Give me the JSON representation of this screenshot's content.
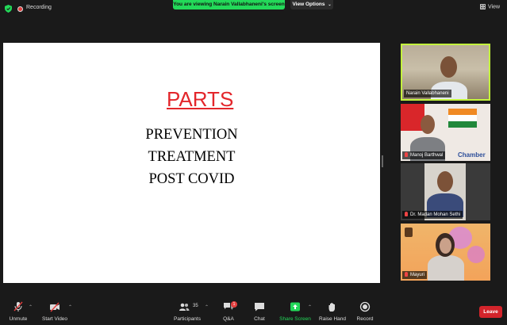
{
  "topbar": {
    "recording_label": "Recording",
    "viewing_banner": "You are viewing Narain Vallabhaneni's screen",
    "view_options_label": "View Options",
    "view_label": "View"
  },
  "slide": {
    "title": "PARTS",
    "lines": [
      "PREVENTION",
      "TREATMENT",
      "POST COVID"
    ]
  },
  "participants": [
    {
      "name": "Narain Vallabhaneni",
      "muted": false,
      "active": true
    },
    {
      "name": "Manoj Barthwal",
      "muted": true,
      "active": false,
      "background_text": "Chamber"
    },
    {
      "name": "Dr. Madan Mohan Sethi",
      "muted": true,
      "active": false
    },
    {
      "name": "Mayuri",
      "muted": true,
      "active": false
    }
  ],
  "toolbar": {
    "unmute_label": "Unmute",
    "start_video_label": "Start Video",
    "participants_label": "Participants",
    "participants_count": "35",
    "qa_label": "Q&A",
    "qa_badge": "1",
    "chat_label": "Chat",
    "share_screen_label": "Share Screen",
    "raise_hand_label": "Raise Hand",
    "record_label": "Record",
    "leave_label": "Leave"
  },
  "colors": {
    "banner_green": "#23d959",
    "share_green": "#23d959",
    "leave_red": "#d3242b",
    "active_speaker_border": "#c3f53d",
    "slide_title_red": "#e3262b"
  }
}
